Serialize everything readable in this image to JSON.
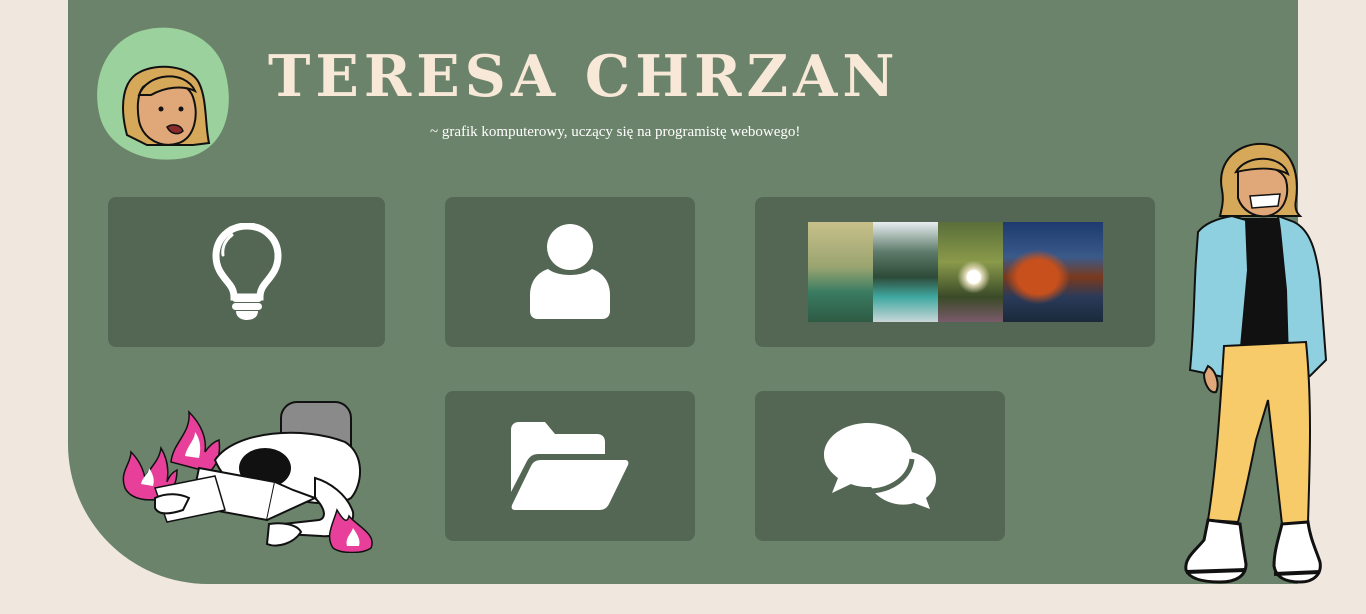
{
  "header": {
    "title": "TERESA CHRZAN",
    "subtitle": "~ grafik komputerowy, uczący się na programistę webowego!"
  },
  "tiles": [
    {
      "name": "ideas-tile",
      "icon": "lightbulb-icon"
    },
    {
      "name": "about-tile",
      "icon": "user-icon"
    },
    {
      "name": "gallery-tile",
      "icon": "photo-gallery"
    },
    {
      "name": "portfolio-tile",
      "icon": "folder-open-icon"
    },
    {
      "name": "contact-tile",
      "icon": "comments-icon"
    }
  ],
  "colors": {
    "background": "#f0e8df",
    "panel": "#6b836b",
    "tile": "#546654",
    "title": "#f7e8d7",
    "avatar_blob": "#9bd19c",
    "fire": "#e8409a"
  }
}
